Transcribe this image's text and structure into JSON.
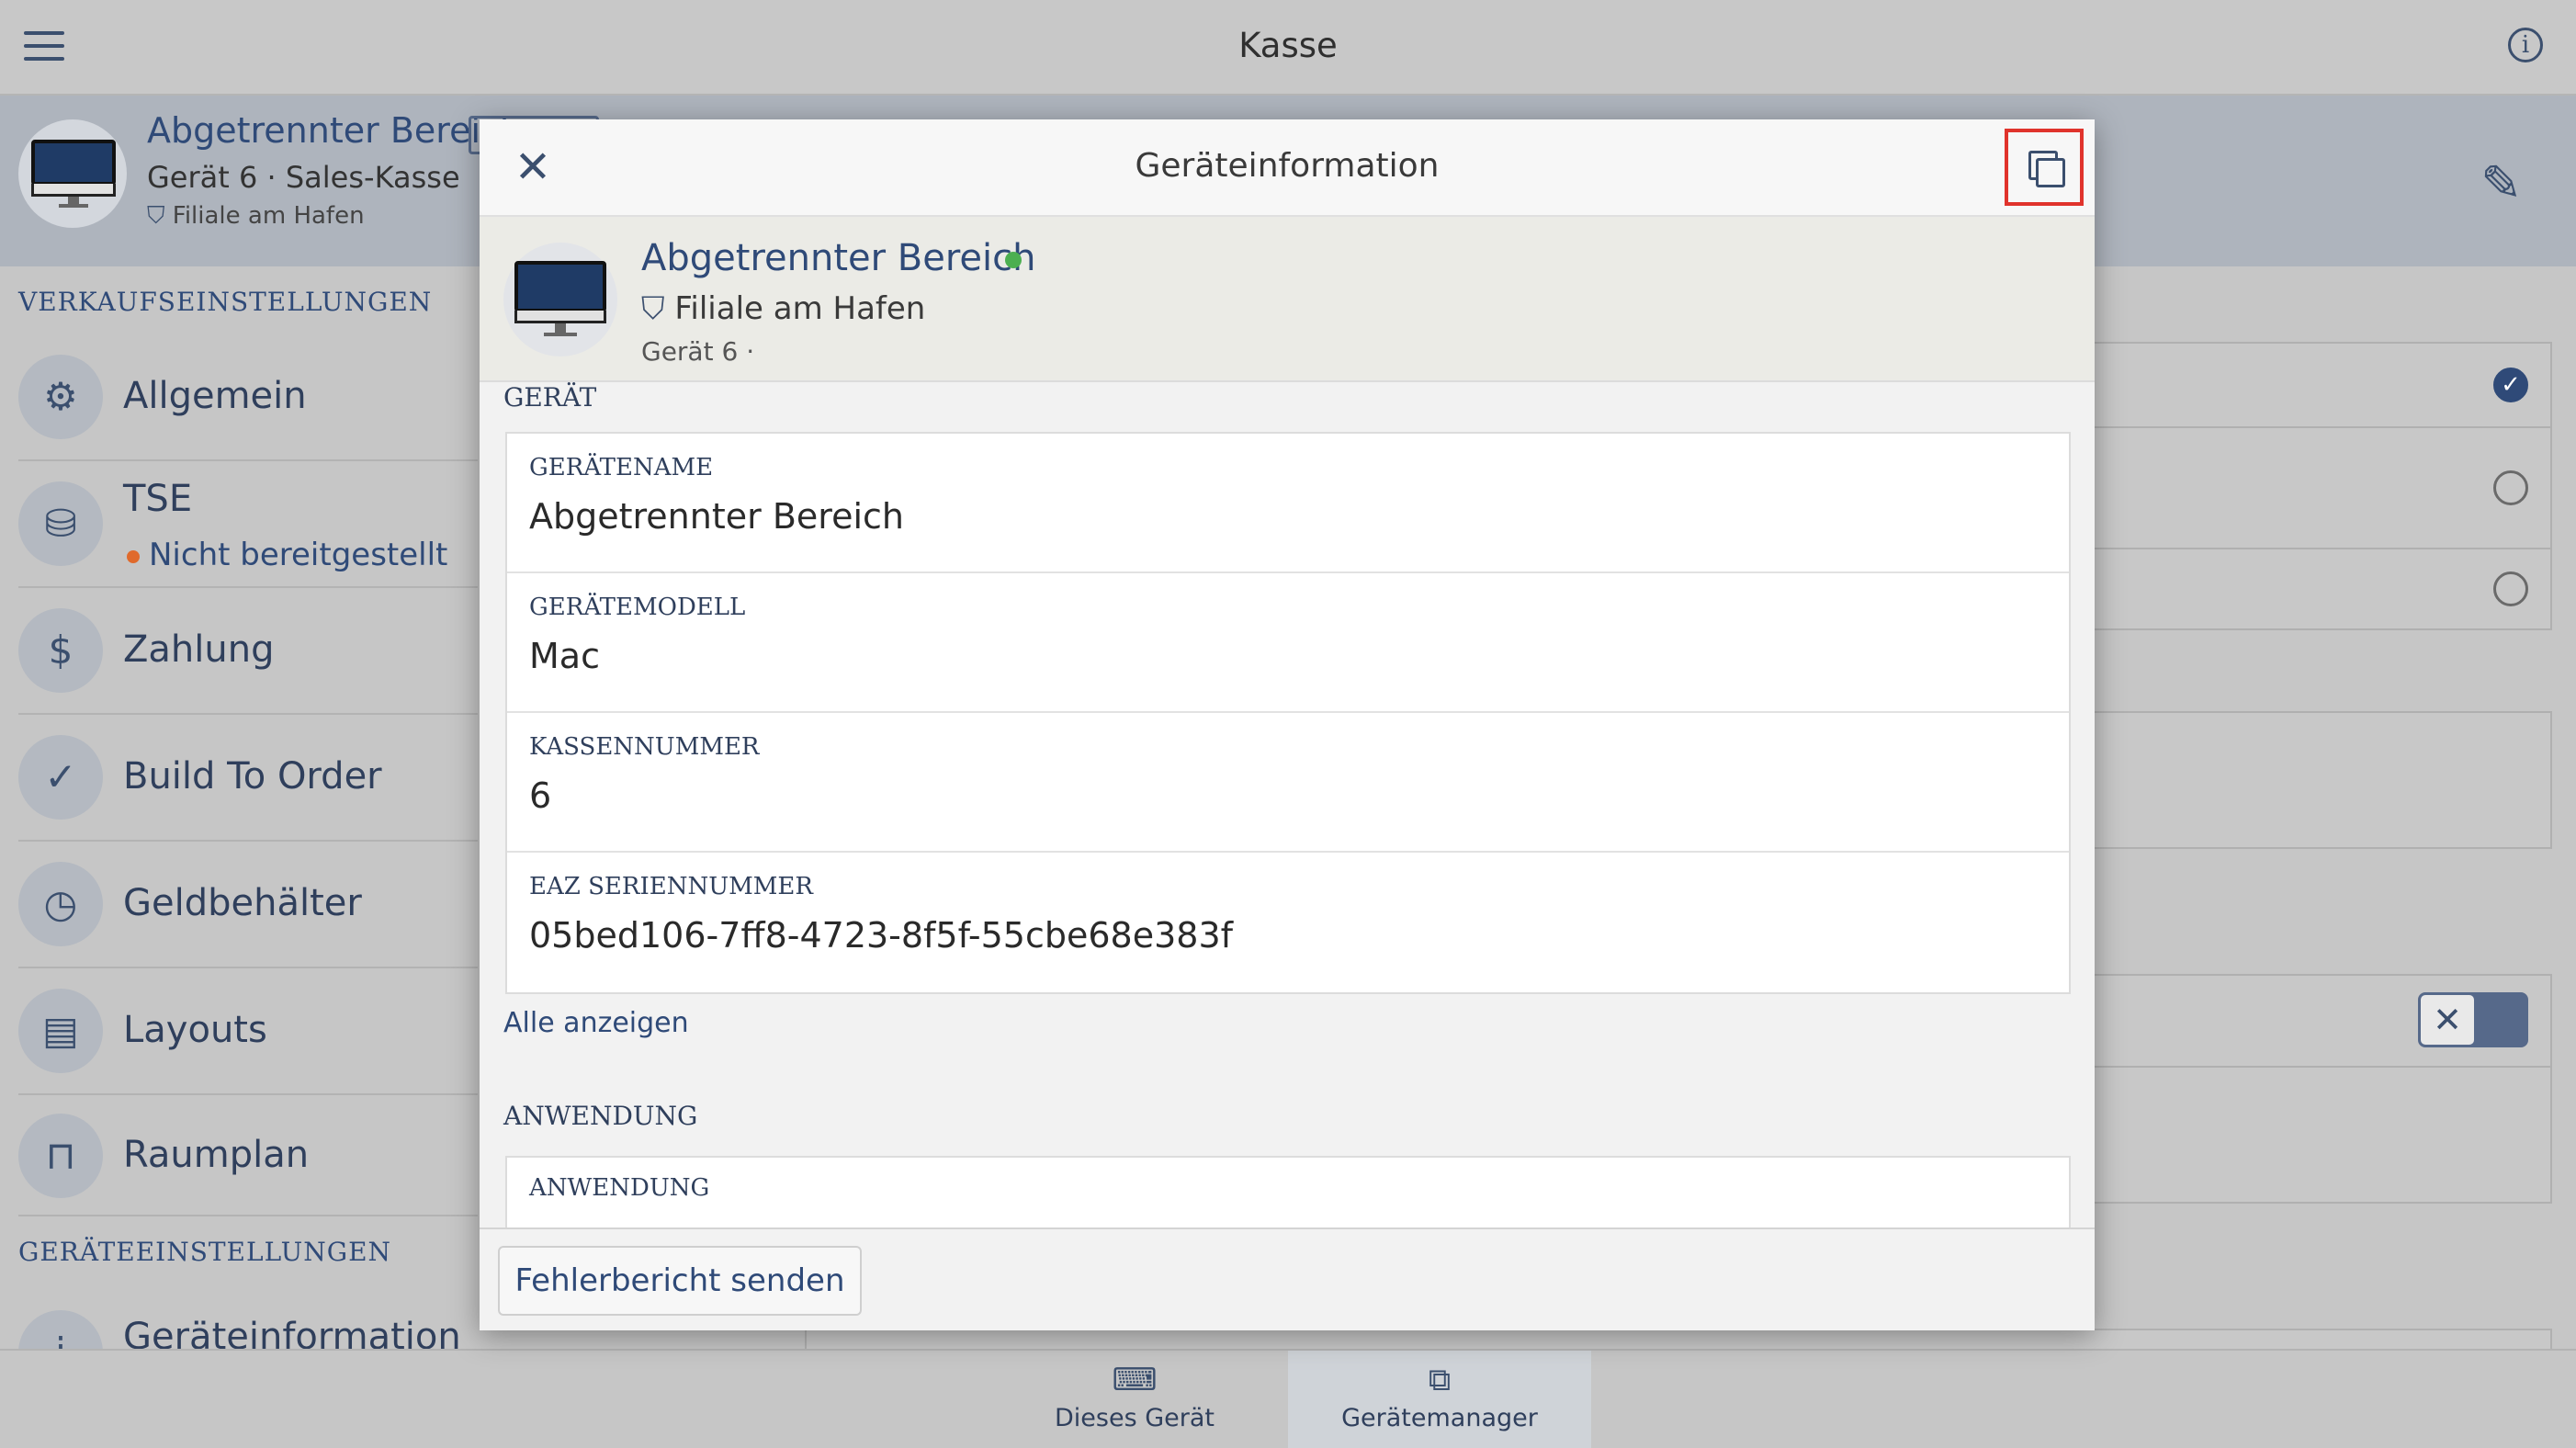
{
  "app": {
    "title": "Kasse"
  },
  "device_header": {
    "name": "Abgetrennter Bereich",
    "subtitle": "Gerät 6 · Sales-Kasse",
    "location": "Filiale am Hafen"
  },
  "sidebar": {
    "section_sales": "VERKAUFSEINSTELLUNGEN",
    "section_device": "GERÄTEEINSTELLUNGEN",
    "items": [
      {
        "label": "Allgemein",
        "icon": "gear-icon"
      },
      {
        "label": "TSE",
        "status": "Nicht bereitgestellt",
        "status_color": "#e06a2c",
        "icon": "tse-icon"
      },
      {
        "label": "Zahlung",
        "icon": "payment-icon"
      },
      {
        "label": "Build To Order",
        "icon": "build-to-order-icon"
      },
      {
        "label": "Geldbehälter",
        "icon": "cash-drawer-icon"
      },
      {
        "label": "Layouts",
        "icon": "register-icon"
      },
      {
        "label": "Raumplan",
        "icon": "table-icon"
      },
      {
        "label": "Geräteinformation",
        "icon": "info-icon"
      }
    ]
  },
  "tabbar": {
    "tabs": [
      {
        "label": "Dieses Gerät",
        "icon": "laptop-icon",
        "active": false
      },
      {
        "label": "Gerätemanager",
        "icon": "devices-icon",
        "active": true
      }
    ]
  },
  "modal": {
    "title": "Geräteinformation",
    "device": {
      "name": "Abgetrennter Bereich",
      "online_color": "#4caf50",
      "location": "Filiale am Hafen",
      "number": "Gerät 6 ·"
    },
    "section_device": "GERÄT",
    "fields": [
      {
        "label": "GERÄTENAME",
        "value": "Abgetrennter Bereich"
      },
      {
        "label": "GERÄTEMODELL",
        "value": "Mac"
      },
      {
        "label": "KASSENNUMMER",
        "value": "6"
      },
      {
        "label": "EAZ SERIENNUMMER",
        "value": "05bed106-7ff8-4723-8f5f-55cbe68e383f"
      }
    ],
    "show_all": "Alle anzeigen",
    "section_application": "ANWENDUNG",
    "application_field_label": "ANWENDUNG",
    "report_button": "Fehlerbericht senden"
  },
  "colors": {
    "accent": "#2f4a78",
    "highlight": "#e0332c"
  }
}
